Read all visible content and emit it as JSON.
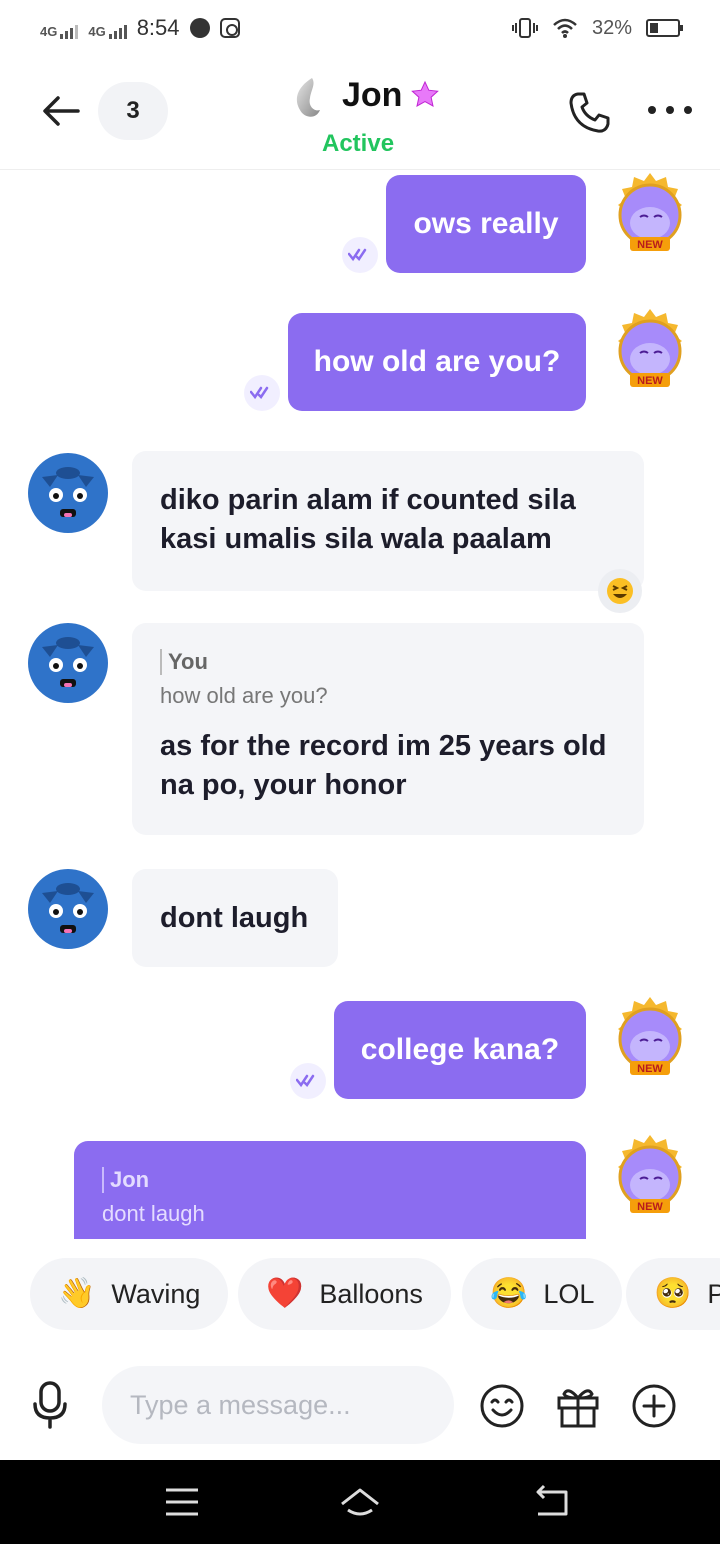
{
  "status_bar": {
    "signal_1": "4G",
    "signal_2": "4G",
    "time": "8:54",
    "battery": "32%"
  },
  "header": {
    "unread_count": "3",
    "contact_name": "Jon",
    "contact_status": "Active"
  },
  "messages": [
    {
      "side": "out",
      "text": "ows really"
    },
    {
      "side": "out",
      "text": "how old are you?"
    },
    {
      "side": "in",
      "text": "diko parin alam if counted sila kasi umalis sila wala paalam",
      "reaction": "grinning-squint-face"
    },
    {
      "side": "in",
      "reply_to_label": "You",
      "reply_to_text": "how old are you?",
      "text": "as for the record im 25 years old na po, your honor"
    },
    {
      "side": "in",
      "text": "dont laugh"
    },
    {
      "side": "out",
      "text": "college kana?"
    },
    {
      "side": "out",
      "reply_to_label": "Jon",
      "reply_to_text": "dont laugh",
      "text": ""
    }
  ],
  "self_avatar_badge": "NEW",
  "quick_reactions": [
    {
      "emoji": "👋",
      "label": "Waving"
    },
    {
      "emoji": "❤️",
      "label": "Balloons"
    },
    {
      "emoji": "😂",
      "label": "LOL"
    },
    {
      "emoji": "🥺",
      "label": "P"
    }
  ],
  "composer": {
    "placeholder": "Type a message..."
  },
  "colors": {
    "accent": "#8b6cf0",
    "active_green": "#22c55e",
    "incoming_bg": "#f4f5f8"
  },
  "icons": [
    "back-arrow-icon",
    "phone-icon",
    "more-icon",
    "star-icon",
    "read-check-icon",
    "mic-icon",
    "emoji-icon",
    "gift-icon",
    "plus-icon",
    "menu-icon",
    "home-icon",
    "nav-back-icon"
  ]
}
